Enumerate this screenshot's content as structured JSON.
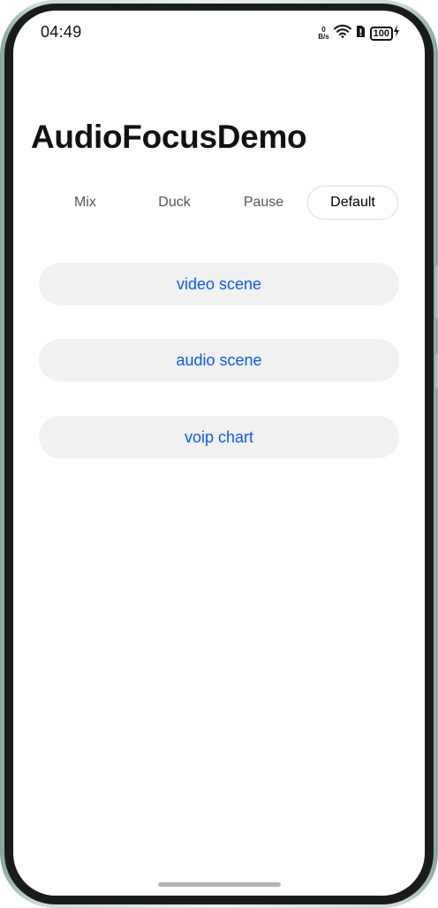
{
  "status_bar": {
    "time": "04:49",
    "net_speed_value": "0",
    "net_speed_unit": "B/s",
    "battery": "100",
    "icons": [
      "wifi-icon",
      "sim-icon",
      "battery-icon",
      "charging-icon"
    ]
  },
  "page": {
    "title": "AudioFocusDemo"
  },
  "tabs": [
    {
      "label": "Mix",
      "active": false
    },
    {
      "label": "Duck",
      "active": false
    },
    {
      "label": "Pause",
      "active": false
    },
    {
      "label": "Default",
      "active": true
    }
  ],
  "buttons": [
    {
      "label": "video scene"
    },
    {
      "label": "audio scene"
    },
    {
      "label": "voip chart"
    }
  ],
  "colors": {
    "accent": "#0a59f7",
    "button_bg": "#f1f1f1",
    "frame": "#c9dbd2"
  }
}
